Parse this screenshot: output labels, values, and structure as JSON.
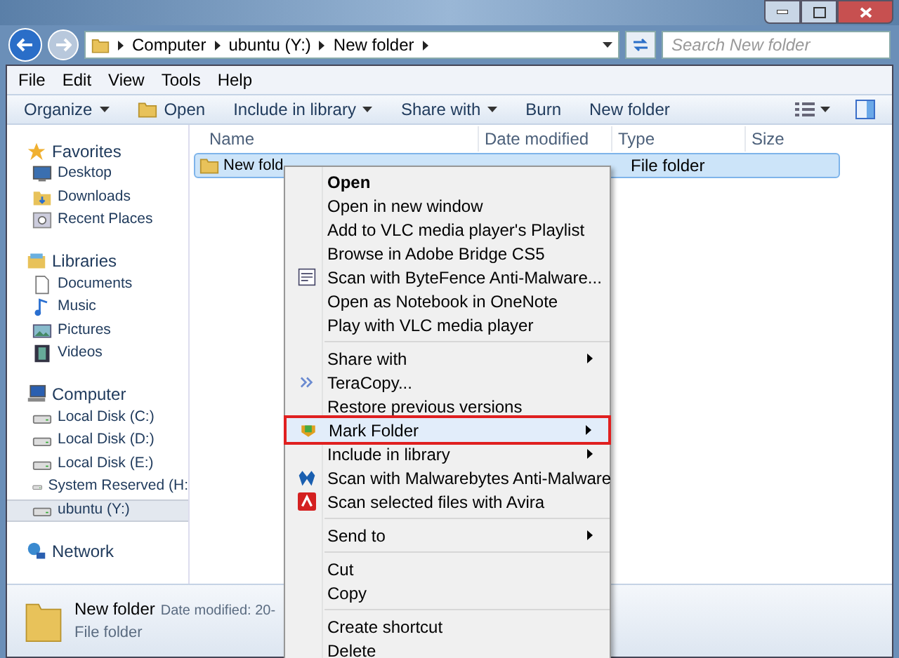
{
  "address_bar": {
    "crumbs": [
      "Computer",
      "ubuntu (Y:)",
      "New folder"
    ]
  },
  "search": {
    "placeholder": "Search New folder"
  },
  "menu_bar": [
    "File",
    "Edit",
    "View",
    "Tools",
    "Help"
  ],
  "toolbar": [
    {
      "label": "Organize",
      "kind": "dropdown"
    },
    {
      "label": "Open",
      "kind": "icon"
    },
    {
      "label": "Include in library",
      "kind": "dropdown"
    },
    {
      "label": "Share with",
      "kind": "dropdown"
    },
    {
      "label": "Burn",
      "kind": "plain"
    },
    {
      "label": "New folder",
      "kind": "plain"
    }
  ],
  "sidebar": {
    "sections": [
      {
        "label": "Favorites",
        "children": [
          {
            "label": "Desktop",
            "selected": false
          },
          {
            "label": "Downloads",
            "selected": false
          },
          {
            "label": "Recent Places",
            "selected": false
          }
        ]
      },
      {
        "label": "Libraries",
        "children": [
          {
            "label": "Documents",
            "selected": false
          },
          {
            "label": "Music",
            "selected": false
          },
          {
            "label": "Pictures",
            "selected": false
          },
          {
            "label": "Videos",
            "selected": false
          }
        ]
      },
      {
        "label": "Computer",
        "children": [
          {
            "label": "Local Disk (C:)",
            "selected": false
          },
          {
            "label": "Local Disk (D:)",
            "selected": false
          },
          {
            "label": "Local Disk (E:)",
            "selected": false
          },
          {
            "label": "System Reserved (H:",
            "selected": false
          },
          {
            "label": "ubuntu (Y:)",
            "selected": true
          }
        ]
      },
      {
        "label": "Network"
      }
    ]
  },
  "table": {
    "columns": [
      "Name",
      "Date modified",
      "Type",
      "Size"
    ],
    "rows": [
      {
        "name": "New fold",
        "type": "File folder",
        "selected": true
      }
    ]
  },
  "context_menu": {
    "items": [
      {
        "kind": "item",
        "label": "Open",
        "bold": true,
        "submenu": false,
        "highlighted": false
      },
      {
        "kind": "item",
        "label": "Open in new window",
        "bold": false,
        "submenu": false,
        "highlighted": false
      },
      {
        "kind": "item",
        "label": "Add to VLC media player's Playlist",
        "bold": false,
        "submenu": false,
        "highlighted": false
      },
      {
        "kind": "item",
        "label": "Browse in Adobe Bridge CS5",
        "bold": false,
        "submenu": false,
        "highlighted": false
      },
      {
        "kind": "item",
        "label": "Scan with ByteFence Anti-Malware...",
        "bold": false,
        "submenu": false,
        "highlighted": false
      },
      {
        "kind": "item",
        "label": "Open as Notebook in OneNote",
        "bold": false,
        "submenu": false,
        "highlighted": false
      },
      {
        "kind": "item",
        "label": "Play with VLC media player",
        "bold": false,
        "submenu": false,
        "highlighted": false
      },
      {
        "kind": "separator"
      },
      {
        "kind": "item",
        "label": "Share with",
        "bold": false,
        "submenu": true,
        "highlighted": false
      },
      {
        "kind": "item",
        "label": "TeraCopy...",
        "bold": false,
        "submenu": false,
        "highlighted": false
      },
      {
        "kind": "item",
        "label": "Restore previous versions",
        "bold": false,
        "submenu": false,
        "highlighted": false
      },
      {
        "kind": "item",
        "label": "Mark Folder",
        "bold": false,
        "submenu": true,
        "highlighted": true
      },
      {
        "kind": "item",
        "label": "Include in library",
        "bold": false,
        "submenu": true,
        "highlighted": false
      },
      {
        "kind": "item",
        "label": "Scan with Malwarebytes Anti-Malware",
        "bold": false,
        "submenu": false,
        "highlighted": false
      },
      {
        "kind": "item",
        "label": "Scan selected files with Avira",
        "bold": false,
        "submenu": false,
        "highlighted": false
      },
      {
        "kind": "separator"
      },
      {
        "kind": "item",
        "label": "Send to",
        "bold": false,
        "submenu": true,
        "highlighted": false
      },
      {
        "kind": "separator"
      },
      {
        "kind": "item",
        "label": "Cut",
        "bold": false,
        "submenu": false,
        "highlighted": false
      },
      {
        "kind": "item",
        "label": "Copy",
        "bold": false,
        "submenu": false,
        "highlighted": false
      },
      {
        "kind": "separator"
      },
      {
        "kind": "item",
        "label": "Create shortcut",
        "bold": false,
        "submenu": false,
        "highlighted": false
      },
      {
        "kind": "item",
        "label": "Delete",
        "bold": false,
        "submenu": false,
        "highlighted": false
      }
    ]
  },
  "details_pane": {
    "name": "New folder",
    "date_label": "Date modified: 20-",
    "type": "File folder"
  }
}
